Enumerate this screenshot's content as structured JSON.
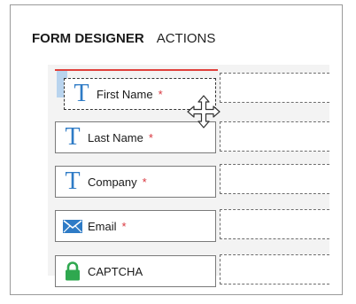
{
  "header": {
    "tabs": [
      {
        "label": "FORM DESIGNER",
        "active": true
      },
      {
        "label": "ACTIONS",
        "active": false
      }
    ]
  },
  "fields": [
    {
      "label": "First Name",
      "icon": "text-t-icon",
      "required": true,
      "required_mark": "*",
      "state": "dragging"
    },
    {
      "label": "Last Name",
      "icon": "text-t-icon",
      "required": true,
      "required_mark": "*"
    },
    {
      "label": "Company",
      "icon": "text-t-icon",
      "required": true,
      "required_mark": "*"
    },
    {
      "label": "Email",
      "icon": "envelope-icon",
      "required": true,
      "required_mark": "*"
    },
    {
      "label": "CAPTCHA",
      "icon": "lock-icon",
      "required": false
    }
  ],
  "icons": {
    "field_type_text_glyph": "T"
  },
  "colors": {
    "accent_blue": "#2e7bc6",
    "required_red": "#d9363e",
    "drop_indicator": "#e0403b",
    "lock_green": "#2fa84f",
    "highlight_blue": "#b9d4ee"
  }
}
